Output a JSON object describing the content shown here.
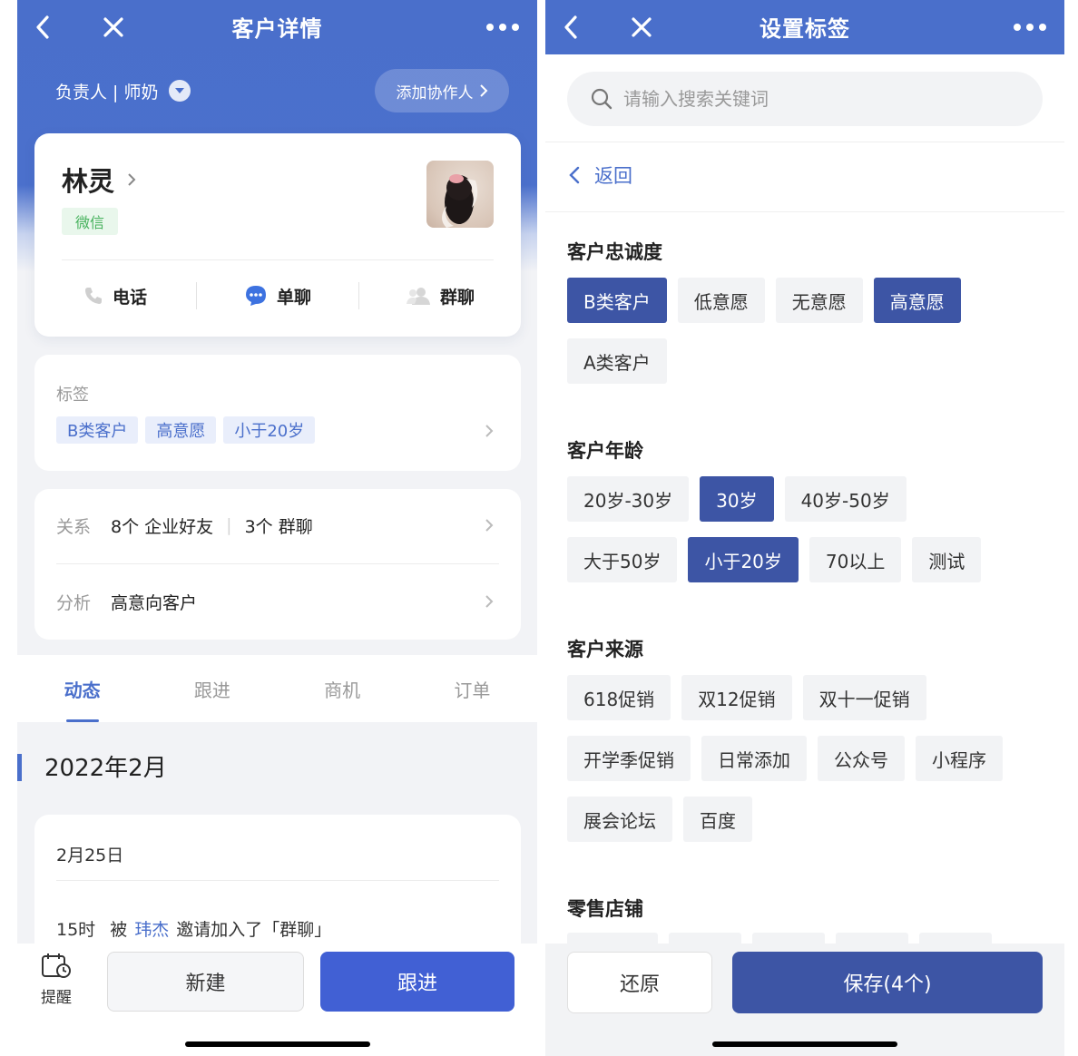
{
  "left": {
    "nav": {
      "title": "客户详情"
    },
    "owner": {
      "label": "负责人 | 师奶"
    },
    "collab_button": "添加协作人",
    "customer": {
      "name": "林灵",
      "source_badge": "微信"
    },
    "actions": [
      {
        "label": "电话",
        "icon": "phone-icon"
      },
      {
        "label": "单聊",
        "icon": "chat-bubble-icon"
      },
      {
        "label": "群聊",
        "icon": "group-icon"
      }
    ],
    "tags_section": {
      "label": "标签",
      "tags": [
        "B类客户",
        "高意愿",
        "小于20岁"
      ]
    },
    "relation": {
      "key": "关系",
      "friends": "8个 企业好友",
      "groups": "3个 群聊"
    },
    "analysis": {
      "key": "分析",
      "value": "高意向客户"
    },
    "tabs": [
      "动态",
      "跟进",
      "商机",
      "订单"
    ],
    "active_tab": "动态",
    "month": "2022年2月",
    "feed": {
      "date": "2月25日",
      "time": "15时",
      "prefix": "被",
      "who": "玮杰",
      "suffix": "邀请加入了「群聊」"
    },
    "bottom": {
      "remind": "提醒",
      "new": "新建",
      "follow": "跟进"
    }
  },
  "right": {
    "nav": {
      "title": "设置标签"
    },
    "search": {
      "placeholder": "请输入搜索关键词"
    },
    "back": "返回",
    "groups": [
      {
        "title": "客户忠诚度",
        "rows": [
          [
            {
              "label": "B类客户",
              "selected": true
            },
            {
              "label": "低意愿",
              "selected": false
            },
            {
              "label": "无意愿",
              "selected": false
            },
            {
              "label": "高意愿",
              "selected": true
            }
          ],
          [
            {
              "label": "A类客户",
              "selected": false
            }
          ]
        ]
      },
      {
        "title": "客户年龄",
        "rows": [
          [
            {
              "label": "20岁-30岁",
              "selected": false
            },
            {
              "label": "30岁",
              "selected": true
            },
            {
              "label": "40岁-50岁",
              "selected": false
            }
          ],
          [
            {
              "label": "大于50岁",
              "selected": false
            },
            {
              "label": "小于20岁",
              "selected": true
            },
            {
              "label": "70以上",
              "selected": false
            },
            {
              "label": "测试",
              "selected": false
            }
          ]
        ]
      },
      {
        "title": "客户来源",
        "rows": [
          [
            {
              "label": "618促销",
              "selected": false
            },
            {
              "label": "双12促销",
              "selected": false
            },
            {
              "label": "双十一促销",
              "selected": false
            }
          ],
          [
            {
              "label": "开学季促销",
              "selected": false
            },
            {
              "label": "日常添加",
              "selected": false
            },
            {
              "label": "公众号",
              "selected": false
            },
            {
              "label": "小程序",
              "selected": false
            }
          ],
          [
            {
              "label": "展会论坛",
              "selected": false
            },
            {
              "label": "百度",
              "selected": false
            }
          ]
        ]
      },
      {
        "title": "零售店铺",
        "rows": []
      }
    ],
    "bottom": {
      "restore": "还原",
      "save": "保存(4个)"
    }
  },
  "colors": {
    "brand_blue": "#4a6fcb",
    "selected_chip": "#3d55a5",
    "primary_button": "#4160d4",
    "wechat_green": "#47b25d"
  }
}
